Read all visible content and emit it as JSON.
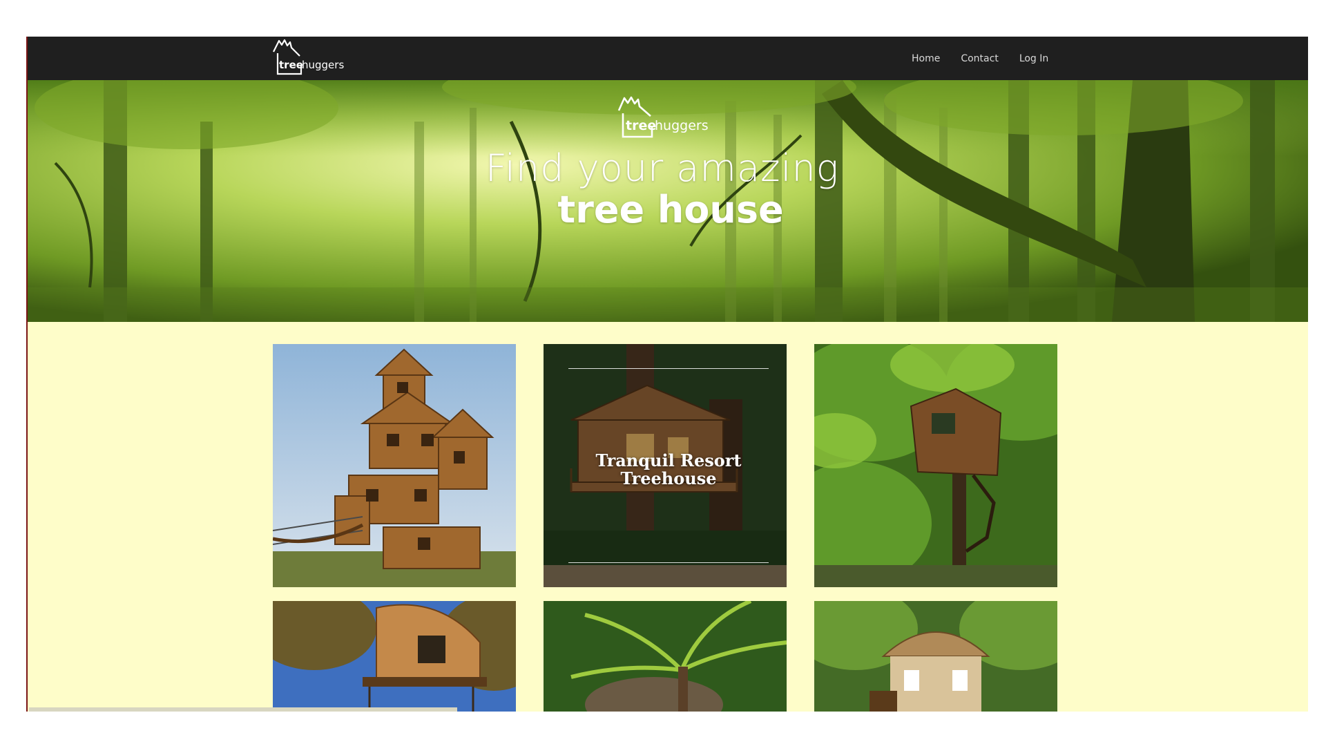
{
  "nav": {
    "logo_prefix": "tree",
    "logo_suffix": "huggers",
    "links": [
      {
        "label": "Home"
      },
      {
        "label": "Contact"
      },
      {
        "label": "Log In"
      }
    ]
  },
  "hero": {
    "logo_prefix": "tree",
    "logo_suffix": "huggers",
    "line1": "Find your amazing",
    "line2": "tree house"
  },
  "gallery": {
    "items": [
      {
        "name": "stacked-wooden-treehouse"
      },
      {
        "name": "tranquil-resort-treehouse",
        "caption_line1": "Tranquil Resort",
        "caption_line2": "Treehouse"
      },
      {
        "name": "forest-cube-treehouse"
      },
      {
        "name": "round-pod-treehouse"
      },
      {
        "name": "palm-treehouse"
      },
      {
        "name": "thatched-roof-treehouse"
      }
    ]
  },
  "colors": {
    "nav_bg": "#1f1f1f",
    "page_bg": "#fefdc9",
    "hero_green": "#8fc23a"
  }
}
